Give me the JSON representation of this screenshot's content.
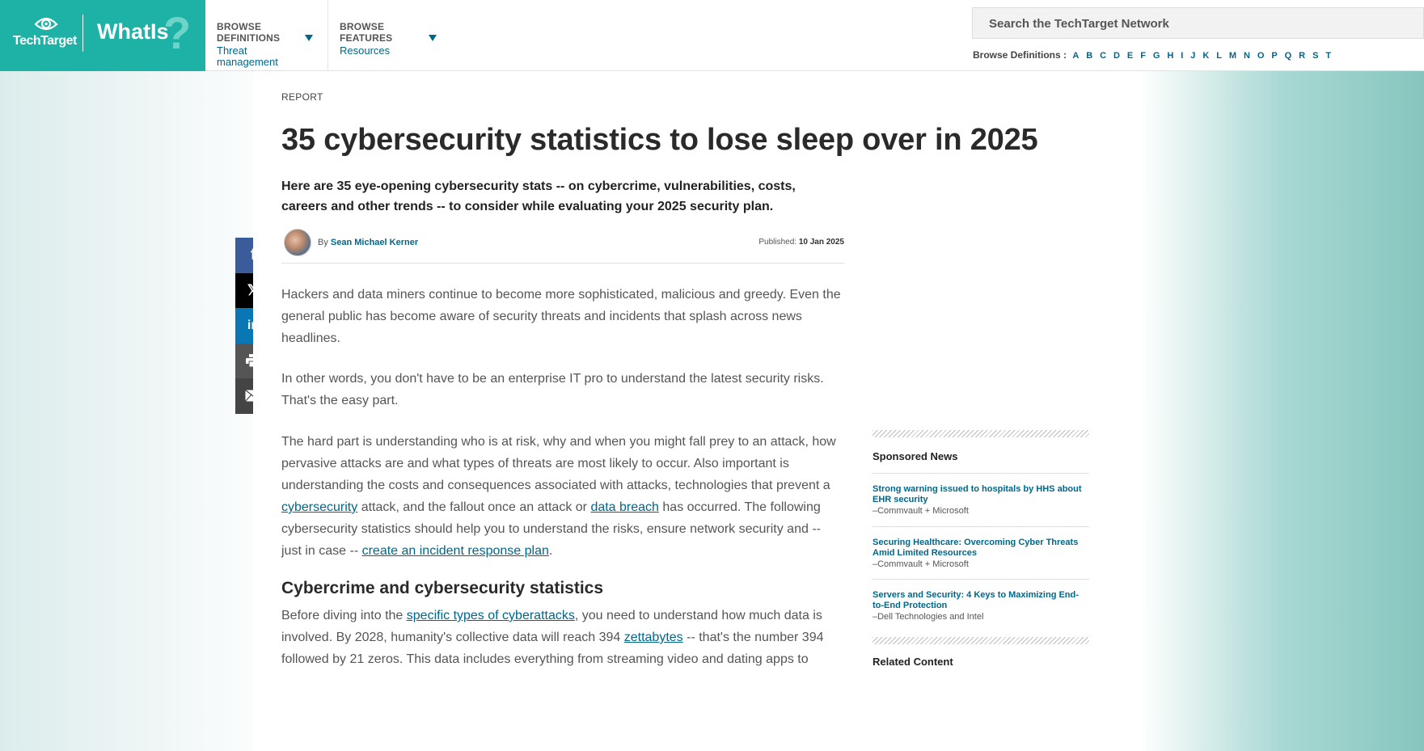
{
  "header": {
    "brand": "TechTarget",
    "site": "WhatIs",
    "site_mark": "?",
    "nav": [
      {
        "heading": "BROWSE DEFINITIONS",
        "value": "Threat management"
      },
      {
        "heading": "BROWSE FEATURES",
        "value": "Resources"
      }
    ],
    "search_placeholder": "Search the TechTarget Network",
    "browse_label": "Browse Definitions :",
    "letters": [
      "A",
      "B",
      "C",
      "D",
      "E",
      "F",
      "G",
      "H",
      "I",
      "J",
      "K",
      "L",
      "M",
      "N",
      "O",
      "P",
      "Q",
      "R",
      "S",
      "T"
    ]
  },
  "article": {
    "tag": "REPORT",
    "title": "35 cybersecurity statistics to lose sleep over in 2025",
    "subtitle": "Here are 35 eye-opening cybersecurity stats -- on cybercrime, vulnerabilities, costs, careers and other trends -- to consider while evaluating your 2025 security plan.",
    "by": "By",
    "author": "Sean Michael Kerner",
    "published_label": "Published:",
    "published_date": "10 Jan 2025",
    "p1": "Hackers and data miners continue to become more sophisticated, malicious and greedy. Even the general public has become aware of security threats and incidents that splash across news headlines.",
    "p2": "In other words, you don't have to be an enterprise IT pro to understand the latest security risks. That's the easy part.",
    "p3": {
      "t1": "The hard part is understanding who is at risk, why and when you might fall prey to an attack, how pervasive attacks are and what types of threats are most likely to occur. Also important is understanding the costs and consequences associated with attacks, technologies that prevent a ",
      "l1": "cybersecurity",
      "t2": " attack, and the fallout once an attack or ",
      "l2": "data breach",
      "t3": " has occurred. The following cybersecurity statistics should help you to understand the risks, ensure network security and -- just in case -- ",
      "l3": "create an incident response plan",
      "t4": "."
    },
    "h2": "Cybercrime and cybersecurity statistics",
    "p4": {
      "t1": "Before diving into the ",
      "l1": "specific types of cyberattacks",
      "t2": ", you need to understand how much data is involved. By 2028, humanity's collective data will reach 394 ",
      "l2": "zettabytes",
      "t3": " -- that's the number 394 followed by 21 zeros. This data includes everything from streaming video and dating apps to"
    }
  },
  "rail": {
    "sponsored_heading": "Sponsored News",
    "items": [
      {
        "title": "Strong warning issued to hospitals by HHS about EHR security",
        "source": "–Commvault + Microsoft"
      },
      {
        "title": "Securing Healthcare: Overcoming Cyber Threats Amid Limited Resources",
        "source": "–Commvault + Microsoft"
      },
      {
        "title": "Servers and Security: 4 Keys to Maximizing End-to-End Protection",
        "source": "–Dell Technologies and Intel"
      }
    ],
    "related_heading": "Related Content"
  },
  "share": {
    "facebook": "f",
    "x": "𝕏",
    "linkedin": "in"
  },
  "colors": {
    "brand_teal": "#1eb2a6",
    "link": "#00678a"
  }
}
